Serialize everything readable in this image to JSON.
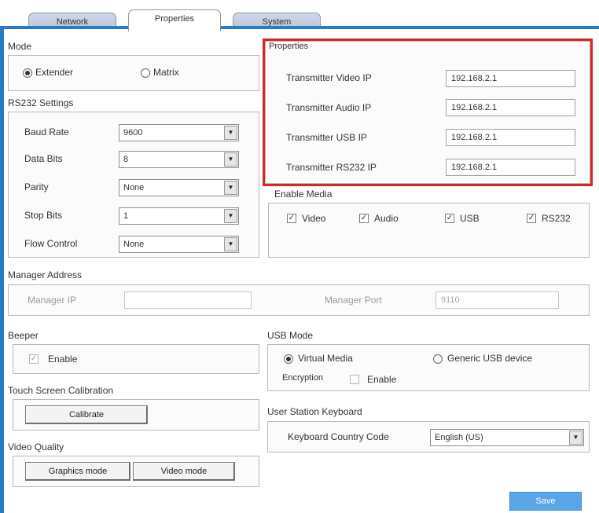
{
  "tabs": [
    {
      "label": "Network"
    },
    {
      "label": "Properties"
    },
    {
      "label": "System"
    }
  ],
  "mode": {
    "title": "Mode",
    "options": [
      {
        "label": "Extender",
        "selected": true
      },
      {
        "label": "Matrix",
        "selected": false
      }
    ]
  },
  "rs232": {
    "title": "RS232 Settings",
    "rows": [
      {
        "label": "Baud Rate",
        "value": "9600"
      },
      {
        "label": "Data Bits",
        "value": "8"
      },
      {
        "label": "Parity",
        "value": "None"
      },
      {
        "label": "Stop Bits",
        "value": "1"
      },
      {
        "label": "Flow Control",
        "value": "None"
      }
    ]
  },
  "properties": {
    "title": "Properties",
    "rows": [
      {
        "label": "Transmitter Video IP",
        "value": "192.168.2.1"
      },
      {
        "label": "Transmitter Audio IP",
        "value": "192.168.2.1"
      },
      {
        "label": "Transmitter USB IP",
        "value": "192.168.2.1"
      },
      {
        "label": "Transmitter RS232 IP",
        "value": "192.168.2.1"
      }
    ]
  },
  "enable_media": {
    "title": "Enable Media",
    "items": [
      {
        "label": "Video",
        "checked": true
      },
      {
        "label": "Audio",
        "checked": true
      },
      {
        "label": "USB",
        "checked": true
      },
      {
        "label": "RS232",
        "checked": true
      }
    ]
  },
  "manager": {
    "title": "Manager Address",
    "ip_label": "Manager IP",
    "ip_value": "",
    "port_label": "Manager Port",
    "port_value": "9110"
  },
  "beeper": {
    "title": "Beeper",
    "enable_label": "Enable",
    "checked": true
  },
  "usb_mode": {
    "title": "USB Mode",
    "options": [
      {
        "label": "Virtual Media",
        "selected": true
      },
      {
        "label": "Generic USB device",
        "selected": false
      }
    ],
    "encryption_label": "Encryption",
    "encryption_enable_label": "Enable",
    "encryption_checked": false
  },
  "touch": {
    "title": "Touch Screen Calibration",
    "button": "Calibrate"
  },
  "keyboard": {
    "title": "User Station Keyboard",
    "label": "Keyboard Country Code",
    "value": "English (US)"
  },
  "video_quality": {
    "title": "Video Quality",
    "buttons": [
      "Graphics mode",
      "Video mode"
    ]
  },
  "footer": {
    "save": "Save"
  },
  "colors": {
    "accent": "#2b79c9",
    "highlight": "#d6252b",
    "save": "#5aa5e8"
  }
}
